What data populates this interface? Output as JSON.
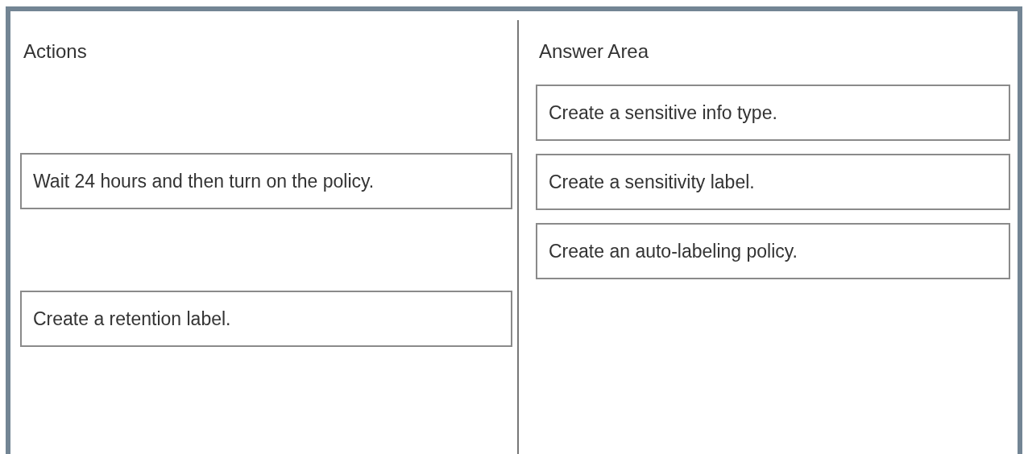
{
  "actions": {
    "heading": "Actions",
    "items": [
      {
        "text": "Wait 24 hours and then turn on the policy."
      },
      {
        "text": "Create a retention label."
      }
    ]
  },
  "answer_area": {
    "heading": "Answer Area",
    "items": [
      {
        "text": "Create a sensitive info type."
      },
      {
        "text": "Create a sensitivity label."
      },
      {
        "text": "Create an auto-labeling policy."
      }
    ]
  }
}
